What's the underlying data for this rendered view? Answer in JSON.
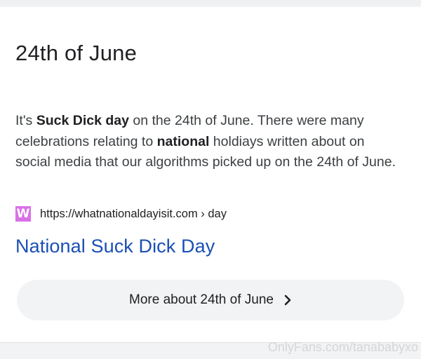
{
  "card": {
    "title": "24th of June",
    "snippet": {
      "part1": "It's ",
      "bold1": "Suck Dick day",
      "part2": " on the 24th of June. There were many celebrations relating to ",
      "bold2": "national",
      "part3": " holdiays written about on social media that our algorithms picked up on the 24th of June."
    },
    "source": {
      "favicon_letter": "W",
      "url": "https://whatnationaldayisit.com › day"
    },
    "link_title": "National Suck Dick Day",
    "more_button": {
      "label": "More about 24th of June",
      "icon": "chevron-right-icon"
    }
  },
  "watermark": "OnlyFans.com/tanababyxo",
  "colors": {
    "link": "#1a4fb5",
    "favicon": "#d971e6",
    "text": "#202124",
    "button_bg": "#f1f3f4"
  }
}
